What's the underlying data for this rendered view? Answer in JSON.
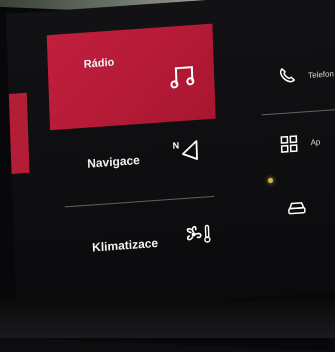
{
  "menu": {
    "radio": {
      "label": "Rádio",
      "icon": "music-note-icon"
    },
    "navigation": {
      "label": "Navigace",
      "icon": "navigation-arrow-icon"
    },
    "climate": {
      "label": "Klimatizace",
      "icon": "fan-temperature-icon"
    }
  },
  "right_column": {
    "phone": {
      "label": "Telefon",
      "icon": "phone-icon"
    },
    "apps": {
      "label": "Ap",
      "icon": "apps-grid-icon"
    },
    "vehicle": {
      "icon": "car-icon"
    }
  },
  "colors": {
    "accent": "#c21f3d",
    "text": "#f2f2f2",
    "background": "#0d0d0f"
  }
}
